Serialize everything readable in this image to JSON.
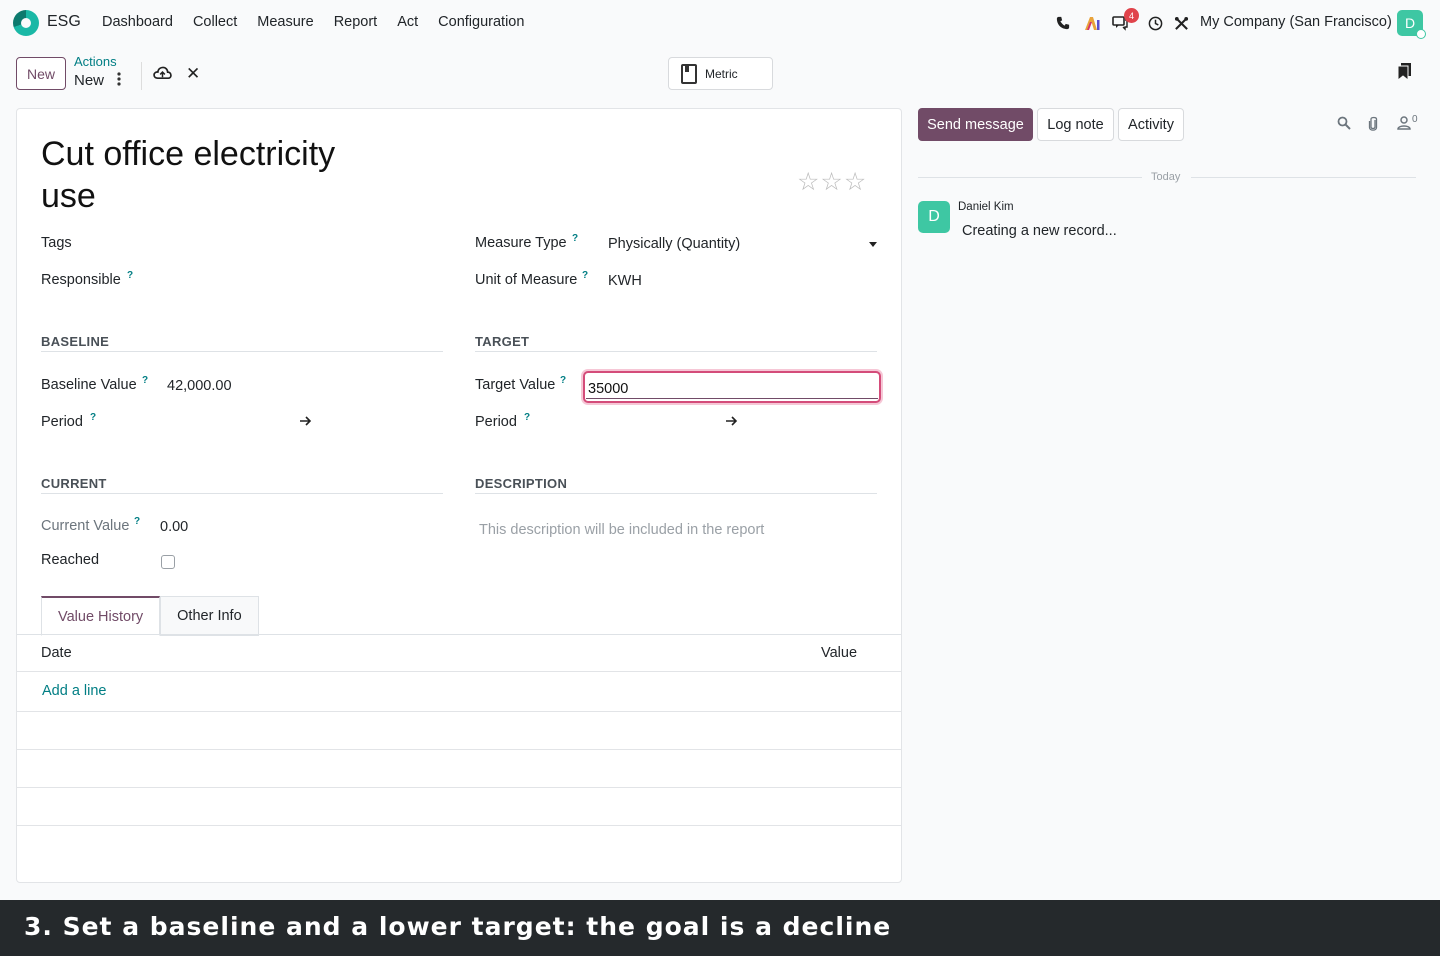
{
  "nav": {
    "app_name": "ESG",
    "menu": [
      "Dashboard",
      "Collect",
      "Measure",
      "Report",
      "Act",
      "Configuration"
    ],
    "messages_badge": "4",
    "company": "My Company (San Francisco)",
    "user_initial": "D"
  },
  "control": {
    "new_label": "New",
    "breadcrumb_parent": "Actions",
    "breadcrumb_current": "New",
    "metric_label": "Metric"
  },
  "form": {
    "title": "Cut office electricity use",
    "tags_label": "Tags",
    "responsible_label": "Responsible",
    "measure_type_label": "Measure Type",
    "measure_type_value": "Physically (Quantity)",
    "uom_label": "Unit of Measure",
    "uom_value": "KWH",
    "baseline_section": "BASELINE",
    "baseline_value_label": "Baseline Value",
    "baseline_value": "42,000.00",
    "baseline_period_label": "Period",
    "target_section": "TARGET",
    "target_value_label": "Target Value",
    "target_value": "35000",
    "target_period_label": "Period",
    "current_section": "CURRENT",
    "current_value_label": "Current Value",
    "current_value": "0.00",
    "reached_label": "Reached",
    "description_section": "DESCRIPTION",
    "description_placeholder": "This description will be included in the report",
    "help_mark": "?",
    "tabs": [
      "Value History",
      "Other Info"
    ],
    "table": {
      "columns": [
        "Date",
        "Value"
      ],
      "add_line": "Add a line"
    }
  },
  "chatter": {
    "send_message": "Send message",
    "log_note": "Log note",
    "activity": "Activity",
    "followers_count": "0",
    "date_separator": "Today",
    "message": {
      "author": "Daniel Kim",
      "author_initial": "D",
      "body": "Creating a new record..."
    }
  },
  "caption": "3. Set a baseline and a lower target: the goal is a decline",
  "colors": {
    "brand": "#714b67",
    "accent_teal": "#017e84",
    "avatar": "#3ec7a3",
    "focus_border": "#d44c7a"
  }
}
